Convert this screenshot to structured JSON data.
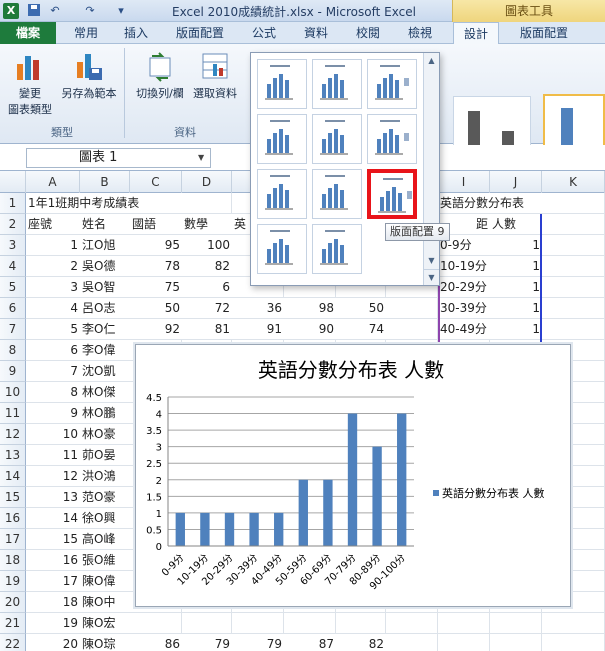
{
  "window": {
    "title": "Excel 2010成績統計.xlsx - Microsoft Excel",
    "contextual_group": "圖表工具",
    "qa_icons": [
      "save-icon",
      "undo-icon",
      "redo-icon"
    ]
  },
  "tabs": [
    "檔案",
    "常用",
    "插入",
    "版面配置",
    "公式",
    "資料",
    "校閱",
    "檢視",
    "設計",
    "版面配置"
  ],
  "ribbon": {
    "change_type_l1": "變更",
    "change_type_l2": "圖表類型",
    "save_template": "另存為範本",
    "group_type": "類型",
    "switch_row_col": "切換列/欄",
    "select_data": "選取資料",
    "group_data": "資料"
  },
  "formula_bar": {
    "name_box": "圖表 1"
  },
  "gallery": {
    "tooltip": "版面配置 9",
    "selected_index": 8
  },
  "columns": [
    "A",
    "B",
    "C",
    "D",
    "E",
    "F",
    "G",
    "H",
    "I",
    "J",
    "K"
  ],
  "rows": [
    "1",
    "2",
    "3",
    "4",
    "5",
    "6",
    "7",
    "8",
    "9",
    "10",
    "11",
    "12",
    "13",
    "14",
    "15",
    "16",
    "17",
    "18",
    "19",
    "20",
    "21",
    "22",
    "23"
  ],
  "sheet": {
    "a1": "1年1班期中考成績表",
    "headers": [
      "座號",
      "姓名",
      "國語",
      "數學",
      "英"
    ],
    "i1": "英語分數分布表",
    "i2": "距",
    "j2": "人數",
    "table": [
      {
        "no": "1",
        "name": "江O旭",
        "c": "95",
        "d": "100",
        "e": "",
        "f": "",
        "g": ""
      },
      {
        "no": "2",
        "name": "吳O德",
        "c": "78",
        "d": "82",
        "e": "",
        "f": "",
        "g": ""
      },
      {
        "no": "3",
        "name": "吳O智",
        "c": "75",
        "d": "6",
        "e": "",
        "f": "",
        "g": ""
      },
      {
        "no": "4",
        "name": "呂O志",
        "c": "50",
        "d": "72",
        "e": "36",
        "f": "98",
        "g": "50"
      },
      {
        "no": "5",
        "name": "李O仁",
        "c": "92",
        "d": "81",
        "e": "91",
        "f": "90",
        "g": "74"
      },
      {
        "no": "6",
        "name": "李O偉",
        "c": "",
        "d": "",
        "e": "",
        "f": "",
        "g": ""
      },
      {
        "no": "7",
        "name": "沈O凱",
        "c": "",
        "d": "",
        "e": "",
        "f": "",
        "g": ""
      },
      {
        "no": "8",
        "name": "林O傑",
        "c": "",
        "d": "",
        "e": "",
        "f": "",
        "g": ""
      },
      {
        "no": "9",
        "name": "林O鵬",
        "c": "",
        "d": "",
        "e": "",
        "f": "",
        "g": ""
      },
      {
        "no": "10",
        "name": "林O豪",
        "c": "",
        "d": "",
        "e": "",
        "f": "",
        "g": ""
      },
      {
        "no": "11",
        "name": "茆O晏",
        "c": "",
        "d": "",
        "e": "",
        "f": "",
        "g": ""
      },
      {
        "no": "12",
        "name": "洪O鴻",
        "c": "",
        "d": "",
        "e": "",
        "f": "",
        "g": ""
      },
      {
        "no": "13",
        "name": "范O豪",
        "c": "",
        "d": "",
        "e": "",
        "f": "",
        "g": ""
      },
      {
        "no": "14",
        "name": "徐O興",
        "c": "",
        "d": "",
        "e": "",
        "f": "",
        "g": ""
      },
      {
        "no": "15",
        "name": "高O峰",
        "c": "",
        "d": "",
        "e": "",
        "f": "",
        "g": ""
      },
      {
        "no": "16",
        "name": "張O維",
        "c": "",
        "d": "",
        "e": "",
        "f": "",
        "g": ""
      },
      {
        "no": "17",
        "name": "陳O偉",
        "c": "",
        "d": "",
        "e": "",
        "f": "",
        "g": ""
      },
      {
        "no": "18",
        "name": "陳O中",
        "c": "",
        "d": "",
        "e": "",
        "f": "",
        "g": ""
      },
      {
        "no": "19",
        "name": "陳O宏",
        "c": "",
        "d": "",
        "e": "",
        "f": "",
        "g": ""
      },
      {
        "no": "20",
        "name": "陳O琮",
        "c": "86",
        "d": "79",
        "e": "79",
        "f": "87",
        "g": "82"
      }
    ],
    "dist": [
      {
        "range": "0-9分",
        "count": "1"
      },
      {
        "range": "10-19分",
        "count": "1"
      },
      {
        "range": "20-29分",
        "count": "1"
      },
      {
        "range": "30-39分",
        "count": "1"
      },
      {
        "range": "40-49分",
        "count": "1"
      }
    ]
  },
  "chart_data": {
    "type": "bar",
    "title": "英語分數分布表 人數",
    "categories": [
      "0-9分",
      "10-19分",
      "20-29分",
      "30-39分",
      "40-49分",
      "50-59分",
      "60-69分",
      "70-79分",
      "80-89分",
      "90-100分"
    ],
    "series": [
      {
        "name": "英語分數分布表 人數",
        "values": [
          1,
          1,
          1,
          1,
          1,
          2,
          2,
          4,
          3,
          4
        ],
        "color": "#4f81bd"
      }
    ],
    "ylim": [
      0,
      4.5
    ],
    "ytick_labels": [
      "0",
      "0.5",
      "1",
      "1.5",
      "2",
      "2.5",
      "3",
      "3.5",
      "4",
      "4.5"
    ],
    "grid": true,
    "legend": "right"
  }
}
